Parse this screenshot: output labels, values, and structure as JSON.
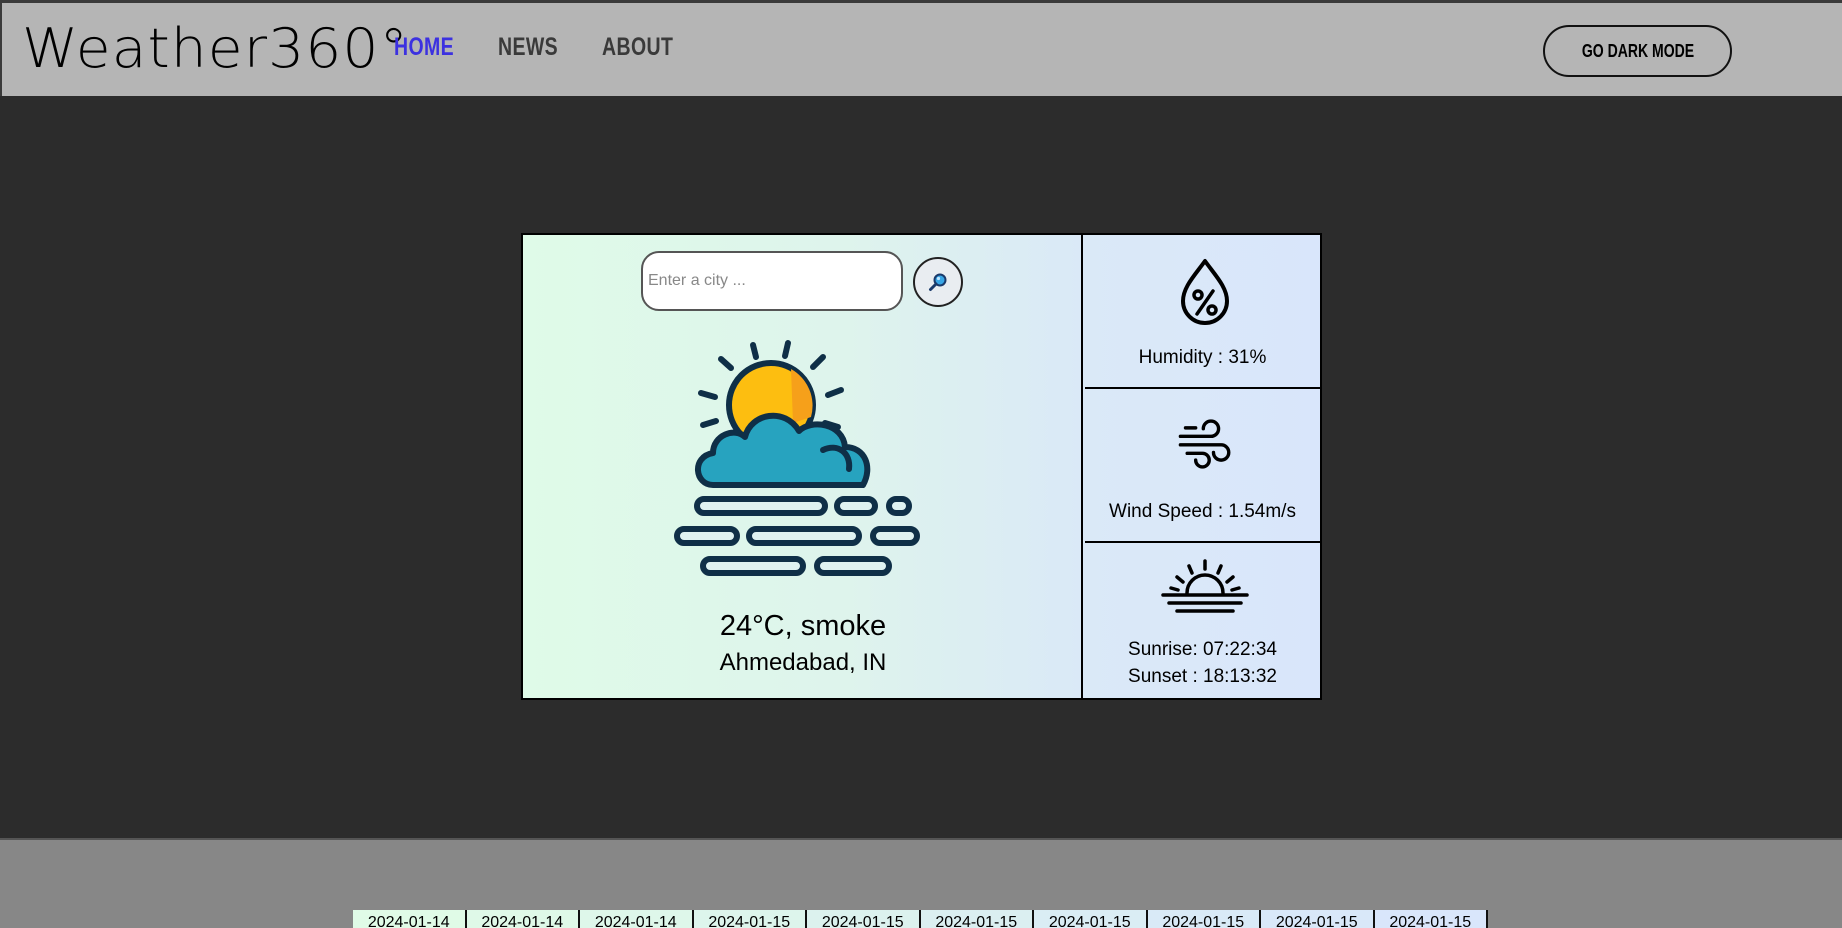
{
  "header": {
    "brand": "Weather360°",
    "nav": [
      {
        "label": "HOME",
        "active": true
      },
      {
        "label": "NEWS",
        "active": false
      },
      {
        "label": "ABOUT",
        "active": false
      }
    ],
    "dark_mode_label": "GO DARK MODE"
  },
  "search": {
    "placeholder": "Enter a city ...",
    "value": "",
    "button_icon": "magnifier-icon"
  },
  "current": {
    "icon": "sun-cloud-mist-icon",
    "temp_condition": "24°C, smoke",
    "location": "Ahmedabad, IN"
  },
  "details": {
    "humidity": {
      "icon": "humidity-drop-icon",
      "text": "Humidity : 31%"
    },
    "wind": {
      "icon": "wind-icon",
      "text": "Wind Speed : 1.54m/s"
    },
    "sun": {
      "icon": "sunrise-icon",
      "sunrise": "Sunrise: 07:22:34",
      "sunset": "Sunset : 18:13:32"
    }
  },
  "forecast": [
    {
      "date": "2024-01-14"
    },
    {
      "date": "2024-01-14"
    },
    {
      "date": "2024-01-14"
    },
    {
      "date": "2024-01-15"
    },
    {
      "date": "2024-01-15"
    },
    {
      "date": "2024-01-15"
    },
    {
      "date": "2024-01-15"
    },
    {
      "date": "2024-01-15"
    },
    {
      "date": "2024-01-15"
    },
    {
      "date": "2024-01-15"
    }
  ],
  "colors": {
    "header_bg": "#b5b5b5",
    "page_bg": "#2c2c2c",
    "footer_bg": "#878787",
    "active_nav": "#3c31e0",
    "card_gradient_start": "#dffbe8",
    "card_gradient_end": "#d9e6fb"
  }
}
